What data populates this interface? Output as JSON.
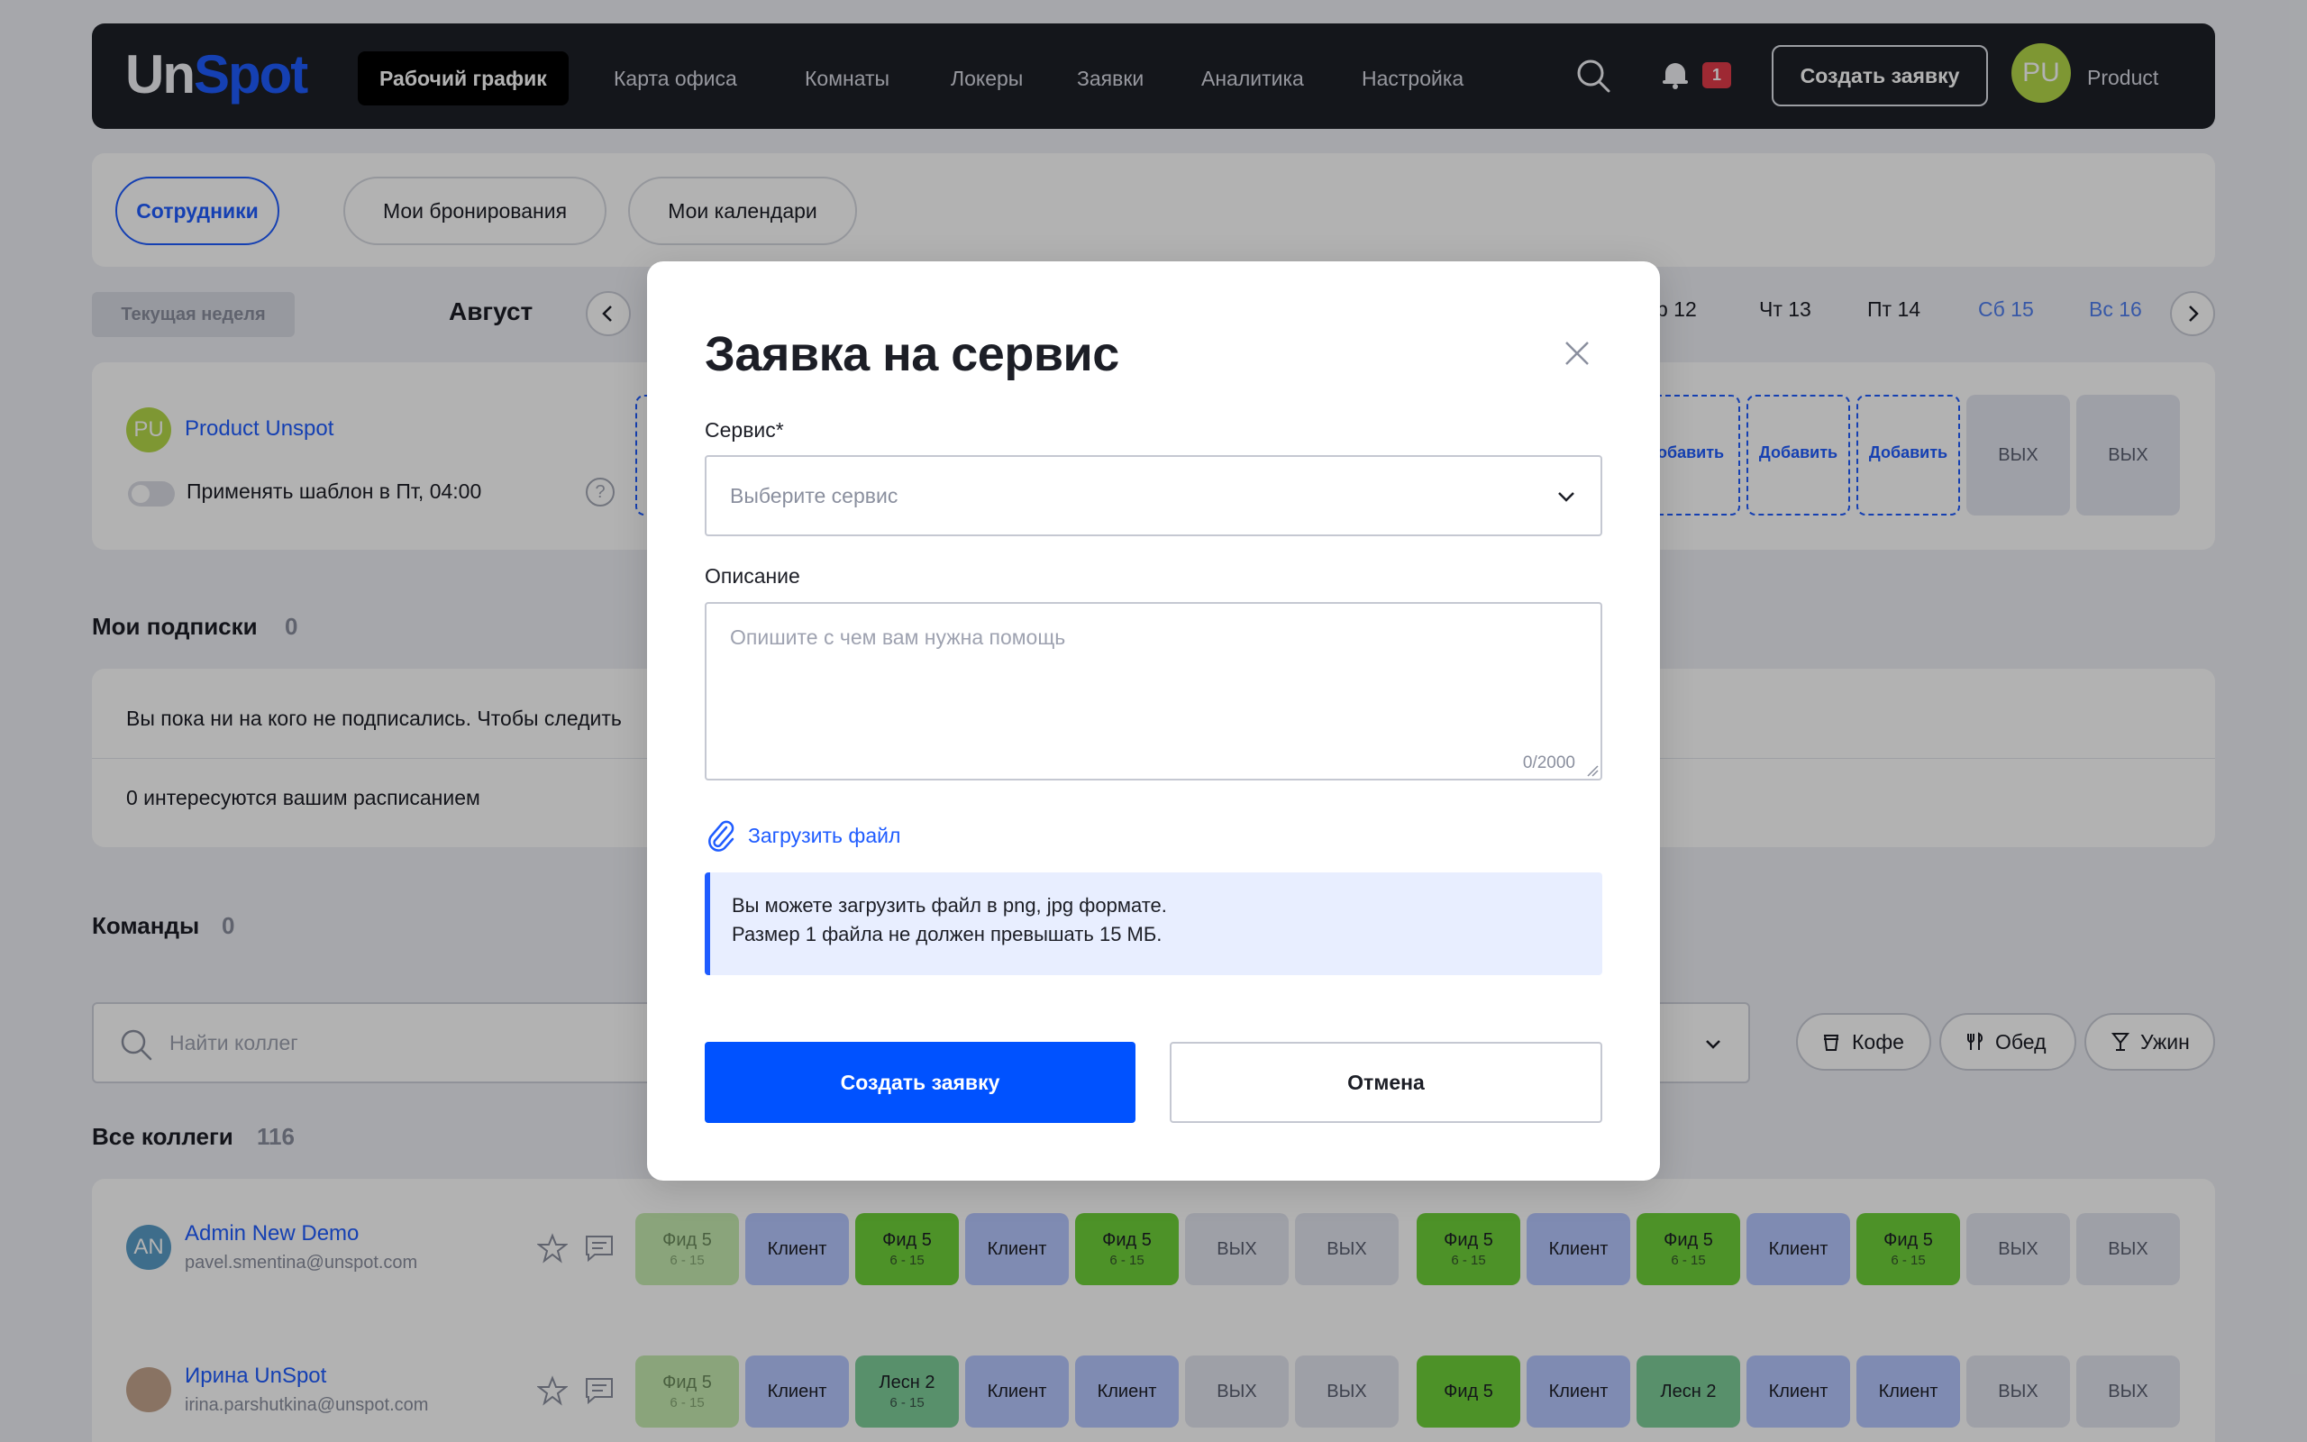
{
  "nav": {
    "logo_un": "Un",
    "logo_spot": "Spot",
    "items": [
      {
        "label": "Рабочий график"
      },
      {
        "label": "Карта офиса"
      },
      {
        "label": "Комнаты"
      },
      {
        "label": "Локеры"
      },
      {
        "label": "Заявки"
      },
      {
        "label": "Аналитика"
      },
      {
        "label": "Настройка"
      }
    ],
    "notification_count": "1",
    "create_label": "Создать заявку",
    "user_initials": "PU",
    "user_name": "Product",
    "search_icon": "search-icon",
    "bell_icon": "bell-icon"
  },
  "subtabs": [
    {
      "label": "Сотрудники"
    },
    {
      "label": "Мои бронирования"
    },
    {
      "label": "Мои календари"
    }
  ],
  "week": {
    "tag": "Текущая неделя",
    "month": "Август",
    "days": [
      "р 12",
      "Чт 13",
      "Пт 14",
      "Сб 15",
      "Вс 16"
    ]
  },
  "me": {
    "initials": "PU",
    "name": "Product Unspot",
    "template_label": "Применять шаблон в Пт, 04:00",
    "help": "?",
    "slots": [
      {
        "label": "Добавить"
      },
      {
        "label": "Добавить"
      },
      {
        "label": "Добавить"
      },
      {
        "label": "ВЫХ"
      },
      {
        "label": "ВЫХ"
      }
    ]
  },
  "subscriptions": {
    "title": "Мои подписки",
    "count": "0",
    "line1": "Вы пока ни на кого не подписались. Чтобы следить",
    "line2": "0 интересуются вашим расписанием"
  },
  "teams": {
    "title": "Команды",
    "count": "0",
    "search_placeholder": "Найти коллег",
    "chips": [
      {
        "label": "Кофе"
      },
      {
        "label": "Обед"
      },
      {
        "label": "Ужин"
      }
    ]
  },
  "colleagues": {
    "title": "Все коллеги",
    "count": "116",
    "rows": [
      {
        "initials": "AN",
        "name": "Admin New Demo",
        "email": "pavel.smentina@unspot.com",
        "slots": [
          {
            "kind": "feed-light",
            "label": "Фид 5",
            "sub": "6 - 15"
          },
          {
            "kind": "client",
            "label": "Клиент",
            "sub": ""
          },
          {
            "kind": "feed",
            "label": "Фид 5",
            "sub": "6 - 15"
          },
          {
            "kind": "client",
            "label": "Клиент",
            "sub": ""
          },
          {
            "kind": "feed",
            "label": "Фид 5",
            "sub": "6 - 15"
          },
          {
            "kind": "off",
            "label": "ВЫХ",
            "sub": ""
          },
          {
            "kind": "off",
            "label": "ВЫХ",
            "sub": ""
          },
          {
            "kind": "feed",
            "label": "Фид 5",
            "sub": "6 - 15"
          },
          {
            "kind": "client",
            "label": "Клиент",
            "sub": ""
          },
          {
            "kind": "feed",
            "label": "Фид 5",
            "sub": "6 - 15"
          },
          {
            "kind": "client",
            "label": "Клиент",
            "sub": ""
          },
          {
            "kind": "feed",
            "label": "Фид 5",
            "sub": "6 - 15"
          },
          {
            "kind": "off",
            "label": "ВЫХ",
            "sub": ""
          },
          {
            "kind": "off",
            "label": "ВЫХ",
            "sub": ""
          }
        ]
      },
      {
        "initials": "",
        "name": "Ирина UnSpot",
        "email": "irina.parshutkina@unspot.com",
        "slots": [
          {
            "kind": "feed-light",
            "label": "Фид 5",
            "sub": "6 - 15"
          },
          {
            "kind": "client",
            "label": "Клиент",
            "sub": ""
          },
          {
            "kind": "forest",
            "label": "Лесн 2",
            "sub": "6 - 15"
          },
          {
            "kind": "client",
            "label": "Клиент",
            "sub": ""
          },
          {
            "kind": "client",
            "label": "Клиент",
            "sub": ""
          },
          {
            "kind": "off",
            "label": "ВЫХ",
            "sub": ""
          },
          {
            "kind": "off",
            "label": "ВЫХ",
            "sub": ""
          },
          {
            "kind": "feed",
            "label": "Фид 5",
            "sub": ""
          },
          {
            "kind": "client",
            "label": "Клиент",
            "sub": ""
          },
          {
            "kind": "forest",
            "label": "Лесн 2",
            "sub": ""
          },
          {
            "kind": "client",
            "label": "Клиент",
            "sub": ""
          },
          {
            "kind": "client",
            "label": "Клиент",
            "sub": ""
          },
          {
            "kind": "off",
            "label": "ВЫХ",
            "sub": ""
          },
          {
            "kind": "off",
            "label": "ВЫХ",
            "sub": ""
          }
        ]
      }
    ]
  },
  "modal": {
    "title": "Заявка на сервис",
    "service_label": "Сервис*",
    "service_placeholder": "Выберите сервис",
    "description_label": "Описание",
    "description_placeholder": "Опишите с чем вам нужна помощь",
    "char_count": "0/2000",
    "upload_label": "Загрузить файл",
    "info_line1": "Вы можете загрузить файл в png, jpg формате.",
    "info_line2": "Размер 1 файла не должен превышать 15 МБ.",
    "submit_label": "Создать заявку",
    "cancel_label": "Отмена"
  },
  "colors": {
    "accent": "#1f5cff",
    "primary_button": "#0052ff",
    "nav_bg": "#1d2028",
    "badge": "#e23b4a"
  }
}
